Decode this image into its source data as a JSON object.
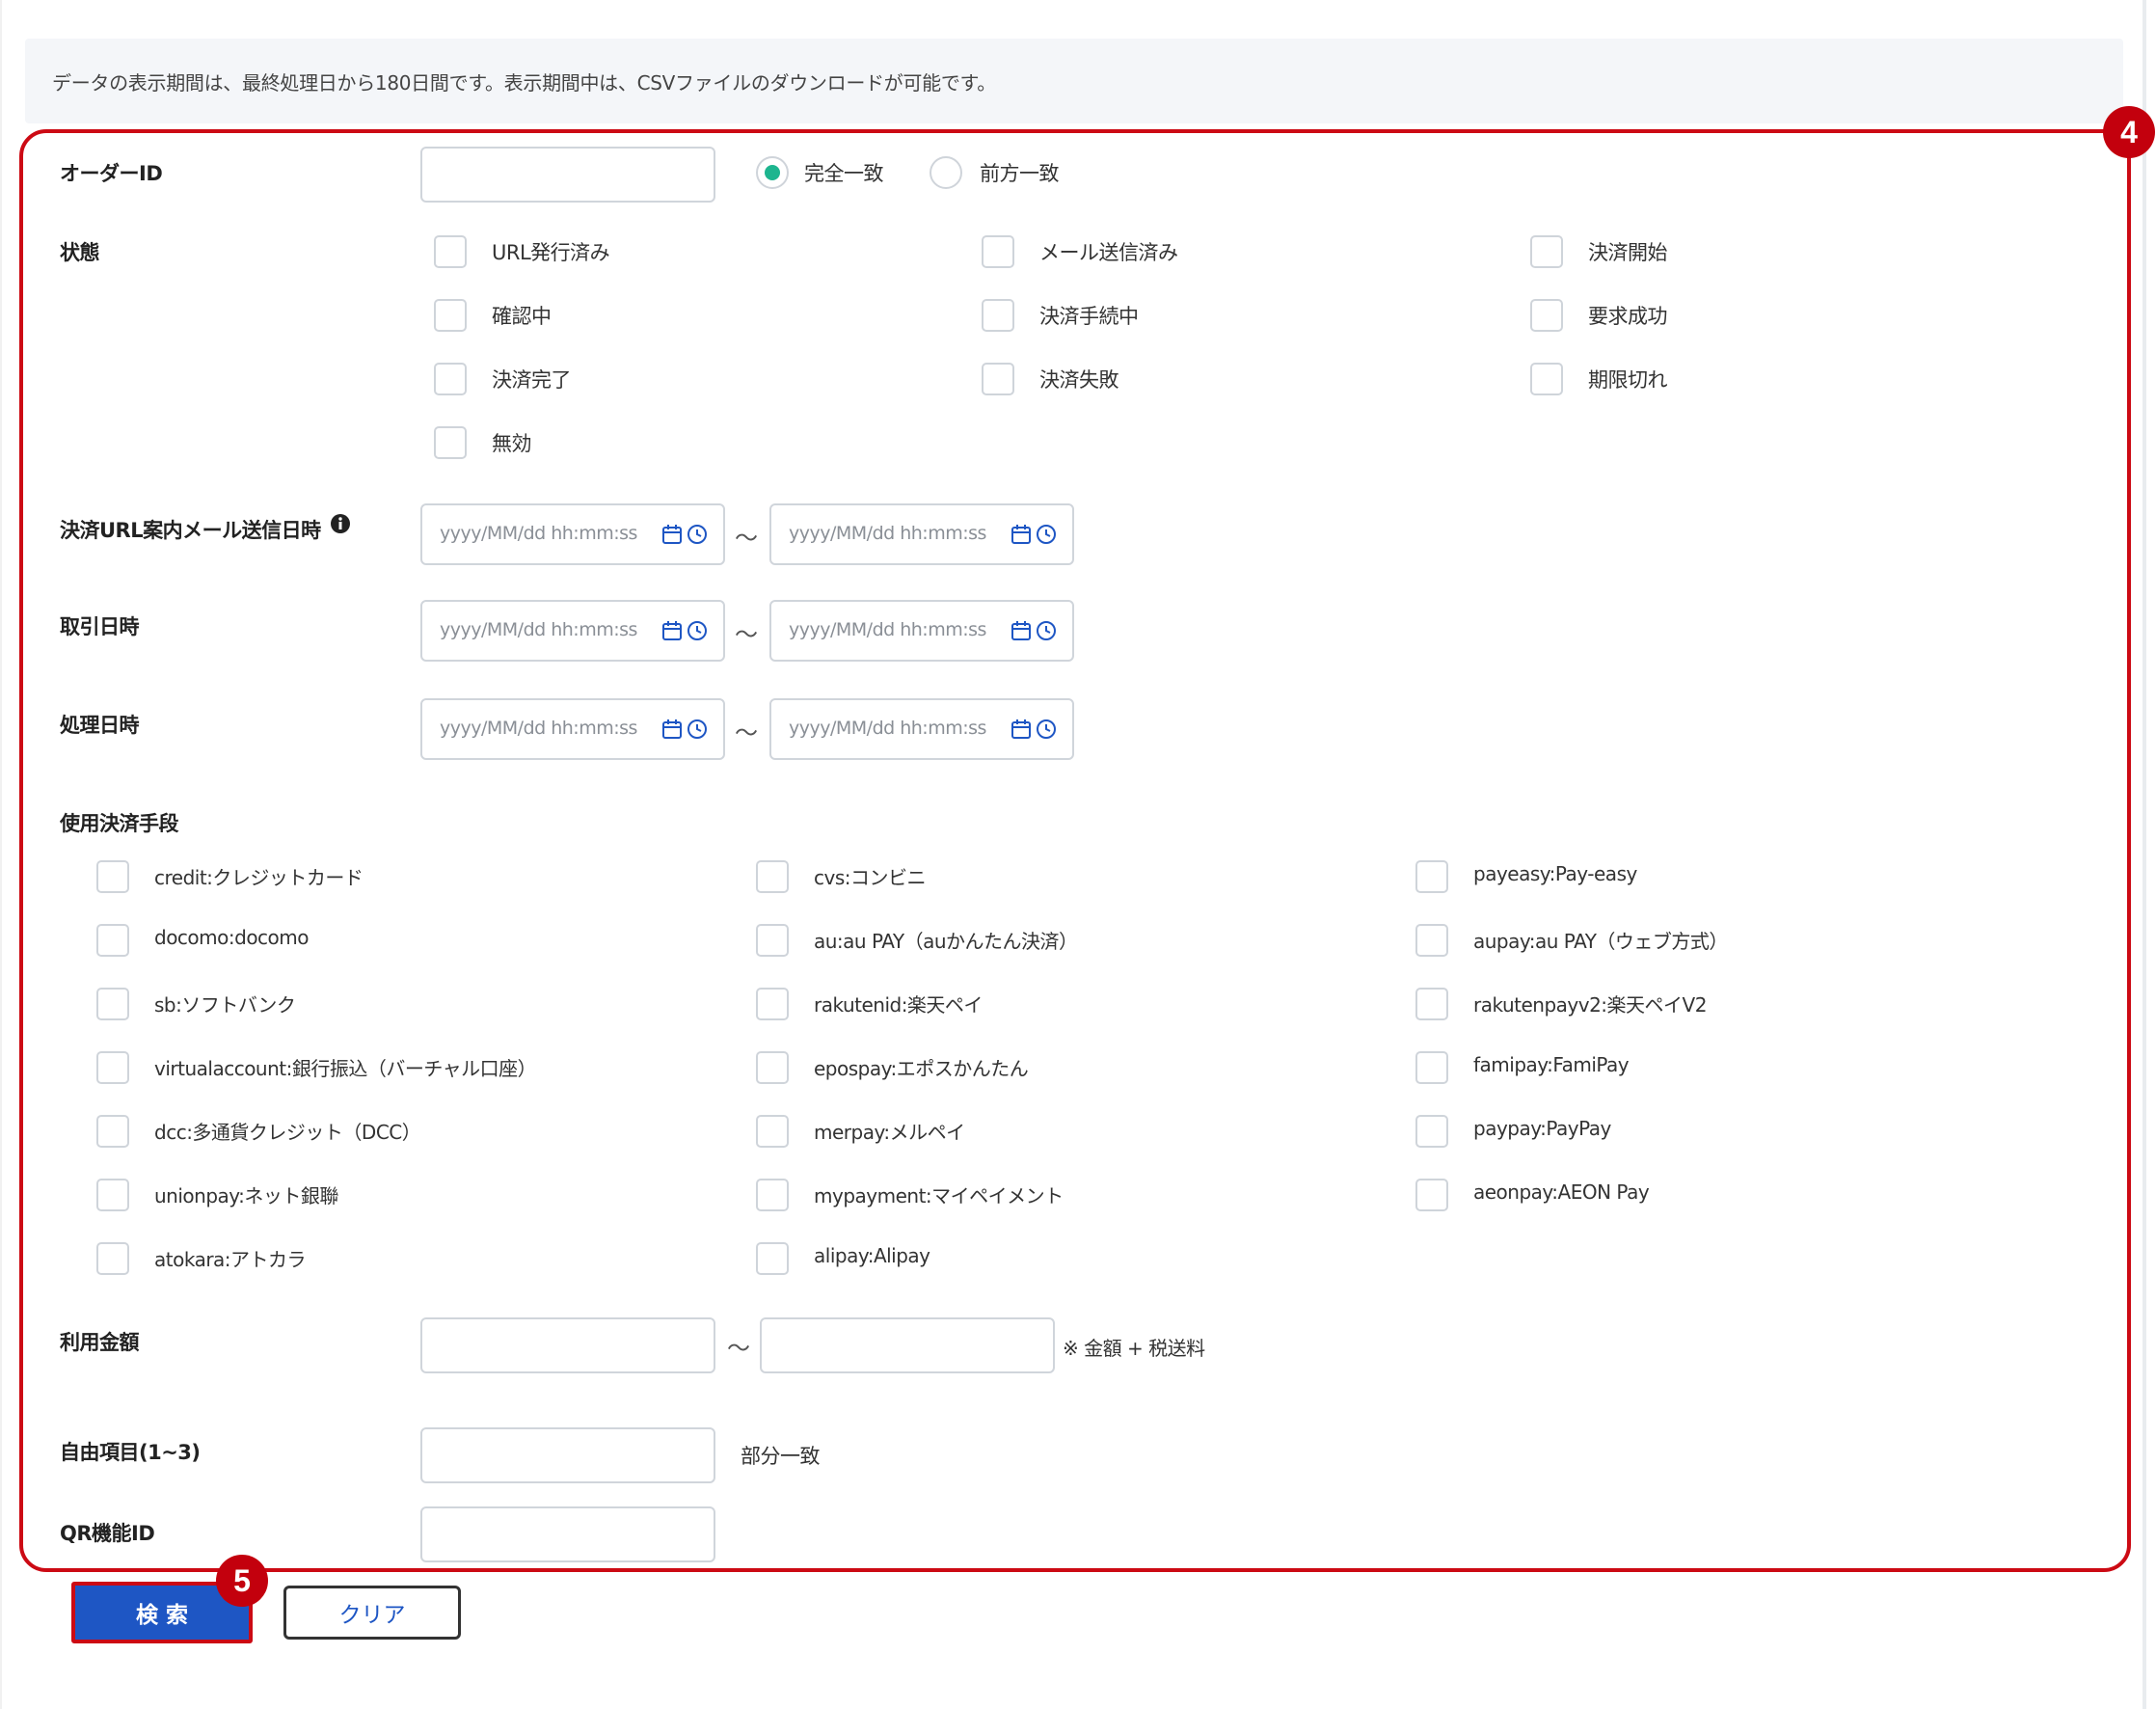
{
  "notice": "データの表示期間は、最終処理日から180日間です。表示期間中は、CSVファイルのダウンロードが可能です。",
  "markers": {
    "form_area": "4",
    "search_button": "5"
  },
  "order_id": {
    "label": "オーダーID",
    "value": "",
    "match_options": [
      {
        "label": "完全一致",
        "selected": true
      },
      {
        "label": "前方一致",
        "selected": false
      }
    ]
  },
  "status": {
    "label": "状態",
    "options": [
      {
        "label": "URL発行済み",
        "checked": false
      },
      {
        "label": "メール送信済み",
        "checked": false
      },
      {
        "label": "決済開始",
        "checked": false
      },
      {
        "label": "確認中",
        "checked": false
      },
      {
        "label": "決済手続中",
        "checked": false
      },
      {
        "label": "要求成功",
        "checked": false
      },
      {
        "label": "決済完了",
        "checked": false
      },
      {
        "label": "決済失敗",
        "checked": false
      },
      {
        "label": "期限切れ",
        "checked": false
      },
      {
        "label": "無効",
        "checked": false
      }
    ]
  },
  "date_placeholder": "yyyy/MM/dd hh:mm:ss",
  "range_separator": "～",
  "mail_sent_datetime": {
    "label": "決済URL案内メール送信日時",
    "from": "",
    "to": ""
  },
  "transaction_datetime": {
    "label": "取引日時",
    "from": "",
    "to": ""
  },
  "processed_datetime": {
    "label": "処理日時",
    "from": "",
    "to": ""
  },
  "payment_methods": {
    "label": "使用決済手段",
    "options": [
      {
        "label": "credit:クレジットカード",
        "checked": false
      },
      {
        "label": "cvs:コンビニ",
        "checked": false
      },
      {
        "label": "payeasy:Pay-easy",
        "checked": false
      },
      {
        "label": "docomo:docomo",
        "checked": false
      },
      {
        "label": "au:au PAY（auかんたん決済）",
        "checked": false
      },
      {
        "label": "aupay:au PAY（ウェブ方式）",
        "checked": false
      },
      {
        "label": "sb:ソフトバンク",
        "checked": false
      },
      {
        "label": "rakutenid:楽天ペイ",
        "checked": false
      },
      {
        "label": "rakutenpayv2:楽天ペイV2",
        "checked": false
      },
      {
        "label": "virtualaccount:銀行振込（バーチャル口座）",
        "checked": false
      },
      {
        "label": "epospay:エポスかんたん",
        "checked": false
      },
      {
        "label": "famipay:FamiPay",
        "checked": false
      },
      {
        "label": "dcc:多通貨クレジット（DCC）",
        "checked": false
      },
      {
        "label": "merpay:メルペイ",
        "checked": false
      },
      {
        "label": "paypay:PayPay",
        "checked": false
      },
      {
        "label": "unionpay:ネット銀聯",
        "checked": false
      },
      {
        "label": "mypayment:マイペイメント",
        "checked": false
      },
      {
        "label": "aeonpay:AEON Pay",
        "checked": false
      },
      {
        "label": "atokara:アトカラ",
        "checked": false
      },
      {
        "label": "alipay:Alipay",
        "checked": false
      }
    ]
  },
  "amount": {
    "label": "利用金額",
    "from": "",
    "to": "",
    "note": "※ 金額 + 税送料"
  },
  "free_items": {
    "label": "自由項目(1~3)",
    "value": "",
    "note": "部分一致"
  },
  "qr_id": {
    "label": "QR機能ID",
    "value": ""
  },
  "buttons": {
    "search": "検 索",
    "clear": "クリア"
  },
  "icons": {
    "calendar": "calendar-icon",
    "clock": "clock-icon",
    "info": "info-icon"
  },
  "colors": {
    "accent_green": "#1db58f",
    "primary_blue": "#1e56c4",
    "highlight_red": "#cc0a14",
    "notice_bg": "#f4f6f9"
  }
}
